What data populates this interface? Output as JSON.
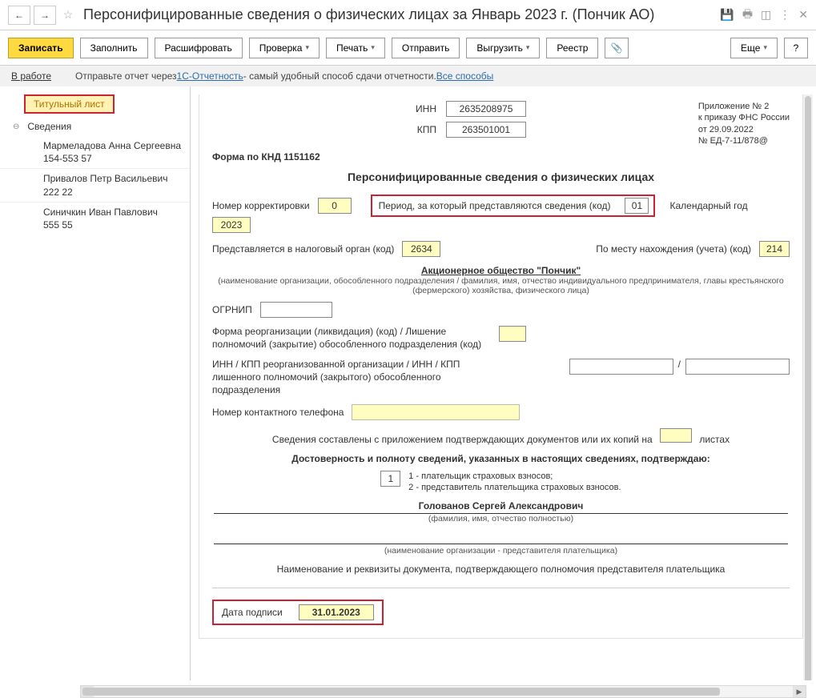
{
  "header": {
    "title": "Персонифицированные сведения о физических лицах за Январь 2023 г. (Пончик АО)"
  },
  "toolbar": {
    "save": "Записать",
    "fill": "Заполнить",
    "decode": "Расшифровать",
    "check": "Проверка",
    "print": "Печать",
    "send": "Отправить",
    "upload": "Выгрузить",
    "registry": "Реестр",
    "more": "Еще",
    "help": "?"
  },
  "infostrip": {
    "status": "В работе",
    "text1": "Отправьте отчет через ",
    "link1": "1С-Отчетность",
    "text2": " - самый удобный способ сдачи отчетности. ",
    "link2": "Все способы"
  },
  "sidebar": {
    "title_page": "Титульный лист",
    "section": "Сведения",
    "persons": [
      {
        "name": "Мармеладова Анна Сергеевна",
        "snils_tail": "154-553 57"
      },
      {
        "name": "Привалов Петр Васильевич",
        "snils_tail": "222 22"
      },
      {
        "name": "Синичкин Иван Павлович",
        "snils_tail": "555 55"
      }
    ]
  },
  "form": {
    "inn_label": "ИНН",
    "inn": "2635208975",
    "kpp_label": "КПП",
    "kpp": "263501001",
    "attach": {
      "l1": "Приложение № 2",
      "l2": "к приказу ФНС России",
      "l3": "от 29.09.2022",
      "l4": "№ ЕД-7-11/878@"
    },
    "knd": "Форма по КНД 1151162",
    "title": "Персонифицированные сведения о физических лицах",
    "corr_label": "Номер корректировки",
    "corr": "0",
    "period_label": "Период, за который представляются сведения (код)",
    "period": "01",
    "year_label": "Календарный год",
    "year": "2023",
    "tax_org_label": "Представляется в налоговый орган (код)",
    "tax_org": "2634",
    "place_label": "По месту нахождения (учета) (код)",
    "place": "214",
    "org_name": "Акционерное общество \"Пончик\"",
    "org_hint": "(наименование организации, обособленного подразделения / фамилия, имя, отчество индивидуального предпринимателя, главы крестьянского (фермерского) хозяйства, физического лица)",
    "ogrnip_label": "ОГРНИП",
    "reorg_label": "Форма реорганизации (ликвидация) (код) / Лишение полномочий (закрытие) обособленного подразделения (код)",
    "reorg_inn_label": "ИНН / КПП реорганизованной организации / ИНН / КПП лишенного полномочий (закрытого) обособленного подразделения",
    "phone_label": "Номер контактного телефона",
    "pages_text_before": "Сведения составлены с приложением подтверждающих документов или их копий на",
    "pages_text_after": "листах",
    "confirm_header": "Достоверность и полноту сведений, указанных в настоящих сведениях, подтверждаю:",
    "confirm_code": "1",
    "confirm_opt1": "1 - плательщик страховых взносов;",
    "confirm_opt2": "2 - представитель плательщика страховых взносов.",
    "signer": "Голованов Сергей Александрович",
    "signer_hint": "(фамилия, имя, отчество полностью)",
    "rep_org_hint": "(наименование организации - представителя плательщика)",
    "doc_text": "Наименование и реквизиты документа, подтверждающего полномочия представителя плательщика",
    "sig_date_label": "Дата подписи",
    "sig_date": "31.01.2023"
  }
}
